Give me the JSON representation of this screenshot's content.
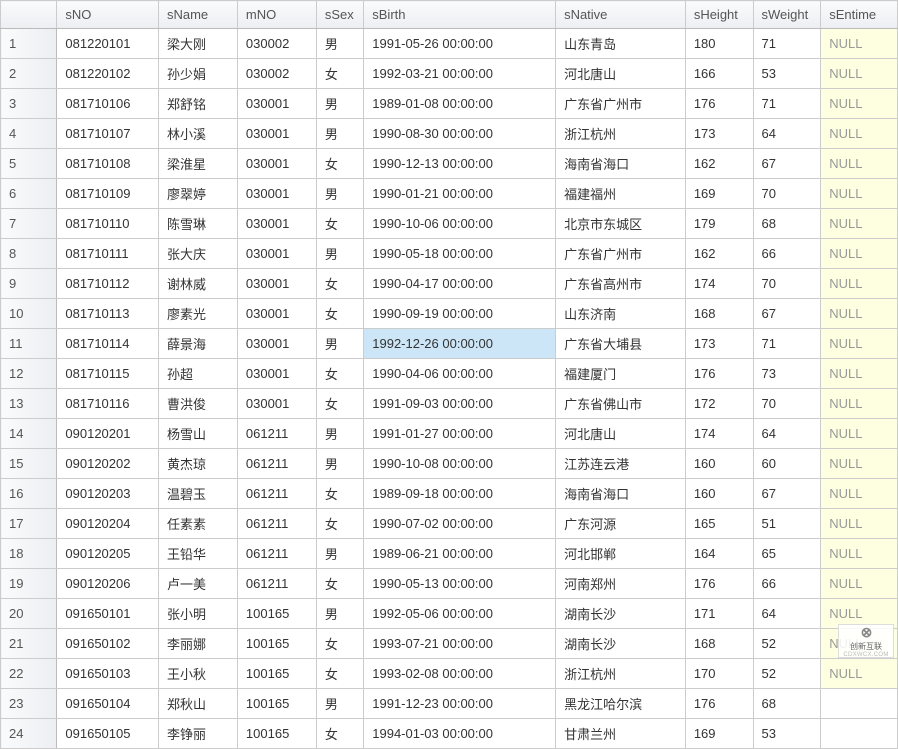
{
  "table": {
    "headers": {
      "rownum": "",
      "sNO": "sNO",
      "sName": "sName",
      "mNO": "mNO",
      "sSex": "sSex",
      "sBirth": "sBirth",
      "sNative": "sNative",
      "sHeight": "sHeight",
      "sWeight": "sWeight",
      "sEntime": "sEntime"
    },
    "rows": [
      {
        "rownum": "1",
        "sNO": "081220101",
        "sName": "梁大刚",
        "mNO": "030002",
        "sSex": "男",
        "sBirth": "1991-05-26 00:00:00",
        "sNative": "山东青岛",
        "sHeight": "180",
        "sWeight": "71",
        "sEntime": "NULL"
      },
      {
        "rownum": "2",
        "sNO": "081220102",
        "sName": "孙少娟",
        "mNO": "030002",
        "sSex": "女",
        "sBirth": "1992-03-21 00:00:00",
        "sNative": "河北唐山",
        "sHeight": "166",
        "sWeight": "53",
        "sEntime": "NULL"
      },
      {
        "rownum": "3",
        "sNO": "081710106",
        "sName": "郑舒铭",
        "mNO": "030001",
        "sSex": "男",
        "sBirth": "1989-01-08 00:00:00",
        "sNative": "广东省广州市",
        "sHeight": "176",
        "sWeight": "71",
        "sEntime": "NULL"
      },
      {
        "rownum": "4",
        "sNO": "081710107",
        "sName": "林小溪",
        "mNO": "030001",
        "sSex": "男",
        "sBirth": "1990-08-30 00:00:00",
        "sNative": "浙江杭州",
        "sHeight": "173",
        "sWeight": "64",
        "sEntime": "NULL"
      },
      {
        "rownum": "5",
        "sNO": "081710108",
        "sName": "梁淮星",
        "mNO": "030001",
        "sSex": "女",
        "sBirth": "1990-12-13 00:00:00",
        "sNative": "海南省海口",
        "sHeight": "162",
        "sWeight": "67",
        "sEntime": "NULL"
      },
      {
        "rownum": "6",
        "sNO": "081710109",
        "sName": "廖翠婷",
        "mNO": "030001",
        "sSex": "男",
        "sBirth": "1990-01-21 00:00:00",
        "sNative": "福建福州",
        "sHeight": "169",
        "sWeight": "70",
        "sEntime": "NULL"
      },
      {
        "rownum": "7",
        "sNO": "081710110",
        "sName": "陈雪琳",
        "mNO": "030001",
        "sSex": "女",
        "sBirth": "1990-10-06 00:00:00",
        "sNative": "北京市东城区",
        "sHeight": "179",
        "sWeight": "68",
        "sEntime": "NULL"
      },
      {
        "rownum": "8",
        "sNO": "081710111",
        "sName": "张大庆",
        "mNO": "030001",
        "sSex": "男",
        "sBirth": "1990-05-18 00:00:00",
        "sNative": "广东省广州市",
        "sHeight": "162",
        "sWeight": "66",
        "sEntime": "NULL"
      },
      {
        "rownum": "9",
        "sNO": "081710112",
        "sName": "谢林威",
        "mNO": "030001",
        "sSex": "女",
        "sBirth": "1990-04-17 00:00:00",
        "sNative": "广东省高州市",
        "sHeight": "174",
        "sWeight": "70",
        "sEntime": "NULL"
      },
      {
        "rownum": "10",
        "sNO": "081710113",
        "sName": "廖素光",
        "mNO": "030001",
        "sSex": "女",
        "sBirth": "1990-09-19 00:00:00",
        "sNative": "山东济南",
        "sHeight": "168",
        "sWeight": "67",
        "sEntime": "NULL"
      },
      {
        "rownum": "11",
        "sNO": "081710114",
        "sName": "薛景海",
        "mNO": "030001",
        "sSex": "男",
        "sBirth": "1992-12-26 00:00:00",
        "sNative": "广东省大埔县",
        "sHeight": "173",
        "sWeight": "71",
        "sEntime": "NULL"
      },
      {
        "rownum": "12",
        "sNO": "081710115",
        "sName": "孙超",
        "mNO": "030001",
        "sSex": "女",
        "sBirth": "1990-04-06 00:00:00",
        "sNative": "福建厦门",
        "sHeight": "176",
        "sWeight": "73",
        "sEntime": "NULL"
      },
      {
        "rownum": "13",
        "sNO": "081710116",
        "sName": "曹洪俊",
        "mNO": "030001",
        "sSex": "女",
        "sBirth": "1991-09-03 00:00:00",
        "sNative": "广东省佛山市",
        "sHeight": "172",
        "sWeight": "70",
        "sEntime": "NULL"
      },
      {
        "rownum": "14",
        "sNO": "090120201",
        "sName": "杨雪山",
        "mNO": "061211",
        "sSex": "男",
        "sBirth": "1991-01-27 00:00:00",
        "sNative": "河北唐山",
        "sHeight": "174",
        "sWeight": "64",
        "sEntime": "NULL"
      },
      {
        "rownum": "15",
        "sNO": "090120202",
        "sName": "黄杰琼",
        "mNO": "061211",
        "sSex": "男",
        "sBirth": "1990-10-08 00:00:00",
        "sNative": "江苏连云港",
        "sHeight": "160",
        "sWeight": "60",
        "sEntime": "NULL"
      },
      {
        "rownum": "16",
        "sNO": "090120203",
        "sName": "温碧玉",
        "mNO": "061211",
        "sSex": "女",
        "sBirth": "1989-09-18 00:00:00",
        "sNative": "海南省海口",
        "sHeight": "160",
        "sWeight": "67",
        "sEntime": "NULL"
      },
      {
        "rownum": "17",
        "sNO": "090120204",
        "sName": "任素素",
        "mNO": "061211",
        "sSex": "女",
        "sBirth": "1990-07-02 00:00:00",
        "sNative": "广东河源",
        "sHeight": "165",
        "sWeight": "51",
        "sEntime": "NULL"
      },
      {
        "rownum": "18",
        "sNO": "090120205",
        "sName": "王铅华",
        "mNO": "061211",
        "sSex": "男",
        "sBirth": "1989-06-21 00:00:00",
        "sNative": "河北邯郸",
        "sHeight": "164",
        "sWeight": "65",
        "sEntime": "NULL"
      },
      {
        "rownum": "19",
        "sNO": "090120206",
        "sName": "卢一美",
        "mNO": "061211",
        "sSex": "女",
        "sBirth": "1990-05-13 00:00:00",
        "sNative": "河南郑州",
        "sHeight": "176",
        "sWeight": "66",
        "sEntime": "NULL"
      },
      {
        "rownum": "20",
        "sNO": "091650101",
        "sName": "张小明",
        "mNO": "100165",
        "sSex": "男",
        "sBirth": "1992-05-06 00:00:00",
        "sNative": "湖南长沙",
        "sHeight": "171",
        "sWeight": "64",
        "sEntime": "NULL"
      },
      {
        "rownum": "21",
        "sNO": "091650102",
        "sName": "李丽娜",
        "mNO": "100165",
        "sSex": "女",
        "sBirth": "1993-07-21 00:00:00",
        "sNative": "湖南长沙",
        "sHeight": "168",
        "sWeight": "52",
        "sEntime": "NULL"
      },
      {
        "rownum": "22",
        "sNO": "091650103",
        "sName": "王小秋",
        "mNO": "100165",
        "sSex": "女",
        "sBirth": "1993-02-08 00:00:00",
        "sNative": "浙江杭州",
        "sHeight": "170",
        "sWeight": "52",
        "sEntime": "NULL"
      },
      {
        "rownum": "23",
        "sNO": "091650104",
        "sName": "郑秋山",
        "mNO": "100165",
        "sSex": "男",
        "sBirth": "1991-12-23 00:00:00",
        "sNative": "黑龙江哈尔滨",
        "sHeight": "176",
        "sWeight": "68",
        "sEntime": ""
      },
      {
        "rownum": "24",
        "sNO": "091650105",
        "sName": "李铮丽",
        "mNO": "100165",
        "sSex": "女",
        "sBirth": "1994-01-03 00:00:00",
        "sNative": "甘肃兰州",
        "sHeight": "169",
        "sWeight": "53",
        "sEntime": ""
      }
    ],
    "selectedCell": {
      "row": 10,
      "col": "sBirth"
    }
  },
  "watermark": {
    "line1": "创新互联",
    "line2": "CDXWCX.COM"
  }
}
